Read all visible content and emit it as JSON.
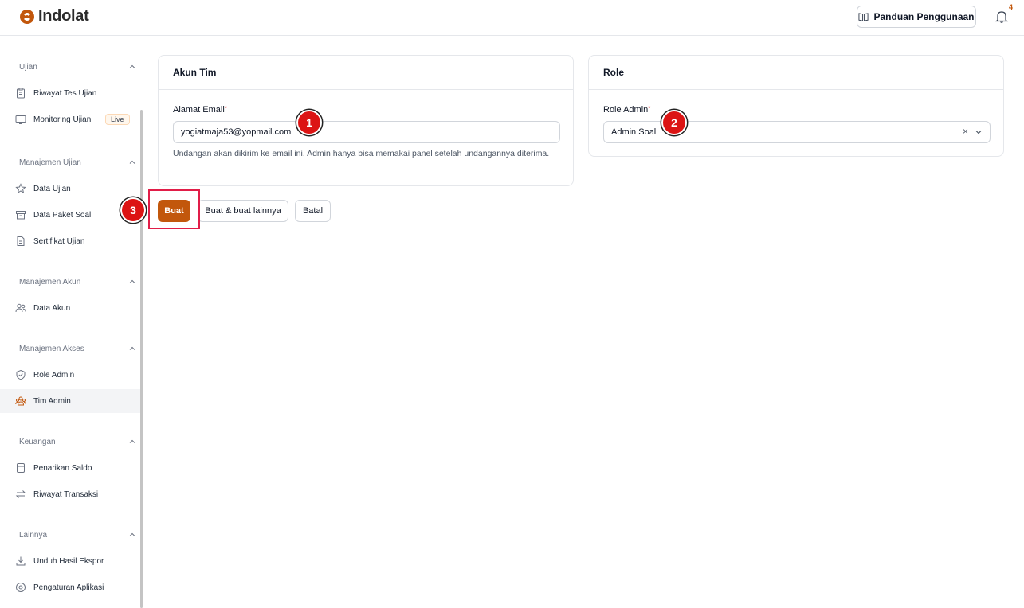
{
  "app": {
    "brand": "Indolat",
    "brand_color": "#c2570c"
  },
  "header": {
    "guide_label": "Panduan Penggunaan",
    "guide_icon": "book-icon",
    "notification_icon": "bell-icon",
    "notification_count": "4"
  },
  "sidebar": {
    "groups": [
      {
        "title": "Ujian",
        "items": [
          {
            "label": "Riwayat Tes Ujian",
            "icon": "clipboard-icon"
          },
          {
            "label": "Monitoring Ujian",
            "icon": "monitor-icon",
            "badge": "Live"
          }
        ]
      },
      {
        "title": "Manajemen Ujian",
        "items": [
          {
            "label": "Data Ujian",
            "icon": "star-icon"
          },
          {
            "label": "Data Paket Soal",
            "icon": "archive-icon"
          },
          {
            "label": "Sertifikat Ujian",
            "icon": "document-icon"
          }
        ]
      },
      {
        "title": "Manajemen Akun",
        "items": [
          {
            "label": "Data Akun",
            "icon": "users-icon"
          }
        ]
      },
      {
        "title": "Manajemen Akses",
        "items": [
          {
            "label": "Role Admin",
            "icon": "shield-check-icon"
          },
          {
            "label": "Tim Admin",
            "icon": "team-icon",
            "active": true
          }
        ]
      },
      {
        "title": "Keuangan",
        "items": [
          {
            "label": "Penarikan Saldo",
            "icon": "wallet-icon"
          },
          {
            "label": "Riwayat Transaksi",
            "icon": "transfer-icon"
          }
        ]
      },
      {
        "title": "Lainnya",
        "items": [
          {
            "label": "Unduh Hasil Ekspor",
            "icon": "download-icon"
          },
          {
            "label": "Pengaturan Aplikasi",
            "icon": "settings-icon"
          }
        ]
      }
    ]
  },
  "form": {
    "account_card": {
      "title": "Akun Tim",
      "email_label": "Alamat Email",
      "required_mark": "*",
      "email_value": "yogiatmaja53@yopmail.com",
      "helper": "Undangan akan dikirim ke email ini. Admin hanya bisa memakai panel setelah undangannya diterima."
    },
    "role_card": {
      "title": "Role",
      "role_label": "Role Admin",
      "required_mark": "*",
      "role_value": "Admin Soal",
      "clear_glyph": "×"
    },
    "actions": {
      "create": "Buat",
      "create_another": "Buat & buat lainnya",
      "cancel": "Batal"
    }
  },
  "annotations": {
    "markers": [
      "1",
      "2",
      "3"
    ],
    "marker_color": "#dc1414",
    "highlight_color": "#e11d48"
  }
}
